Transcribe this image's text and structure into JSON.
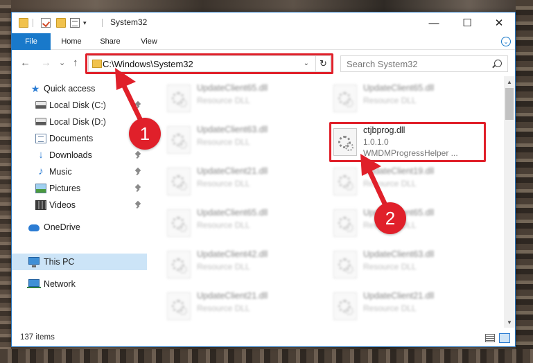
{
  "window": {
    "title": "System32",
    "minimize_glyph": "—",
    "maximize_glyph": "☐",
    "close_glyph": "✕"
  },
  "ribbon": {
    "tabs": [
      {
        "label": "File",
        "active": true
      },
      {
        "label": "Home"
      },
      {
        "label": "Share"
      },
      {
        "label": "View"
      }
    ],
    "expand_glyph": "⌄"
  },
  "navigation": {
    "back_glyph": "←",
    "forward_glyph": "→",
    "recent_glyph": "⌄",
    "up_glyph": "↑",
    "address": "C:\\Windows\\System32",
    "address_dropdown_glyph": "⌄",
    "refresh_glyph": "↻",
    "search_placeholder": "Search System32"
  },
  "sidebar": {
    "items": [
      {
        "label": "Quick access",
        "icon": "star-icon"
      },
      {
        "label": "Local Disk (C:)",
        "icon": "disk-icon",
        "pinned": true
      },
      {
        "label": "Local Disk (D:)",
        "icon": "disk-icon"
      },
      {
        "label": "Documents",
        "icon": "documents-icon",
        "pinned": true
      },
      {
        "label": "Downloads",
        "icon": "download-icon",
        "pinned": true
      },
      {
        "label": "Music",
        "icon": "music-icon",
        "pinned": true
      },
      {
        "label": "Pictures",
        "icon": "pictures-icon",
        "pinned": true
      },
      {
        "label": "Videos",
        "icon": "videos-icon",
        "pinned": true
      },
      {
        "label": "OneDrive",
        "icon": "cloud-icon"
      },
      {
        "label": "This PC",
        "icon": "computer-icon",
        "selected": true
      },
      {
        "label": "Network",
        "icon": "network-icon"
      }
    ]
  },
  "files": [
    {
      "name": "UpdateClient65.dll",
      "type": "Resource DLL"
    },
    {
      "name": "UpdateClient65.dll",
      "type": "Resource DLL"
    },
    {
      "name": "UpdateClient63.dll",
      "type": "Resource DLL"
    },
    {
      "name": "ctjbprog.dll",
      "version": "1.0.1.0",
      "description": "WMDMProgressHelper ...",
      "highlighted": true
    },
    {
      "name": "UpdateClient21.dll",
      "type": "Resource DLL"
    },
    {
      "name": "UpdateClient19.dll",
      "type": "Resource DLL"
    },
    {
      "name": "UpdateClient65.dll",
      "type": "Resource DLL"
    },
    {
      "name": "UpdateClient65.dll",
      "type": "Resource DLL"
    },
    {
      "name": "UpdateClient42.dll",
      "type": "Resource DLL"
    },
    {
      "name": "UpdateClient63.dll",
      "type": "Resource DLL"
    },
    {
      "name": "UpdateClient21.dll",
      "type": "Resource DLL"
    },
    {
      "name": "UpdateClient21.dll",
      "type": "Resource DLL"
    }
  ],
  "scrollbar": {
    "up_glyph": "▲",
    "down_glyph": "▼"
  },
  "status": {
    "item_count": "137 items"
  },
  "annotations": {
    "step1": "1",
    "step2": "2",
    "color": "#e0202a"
  }
}
